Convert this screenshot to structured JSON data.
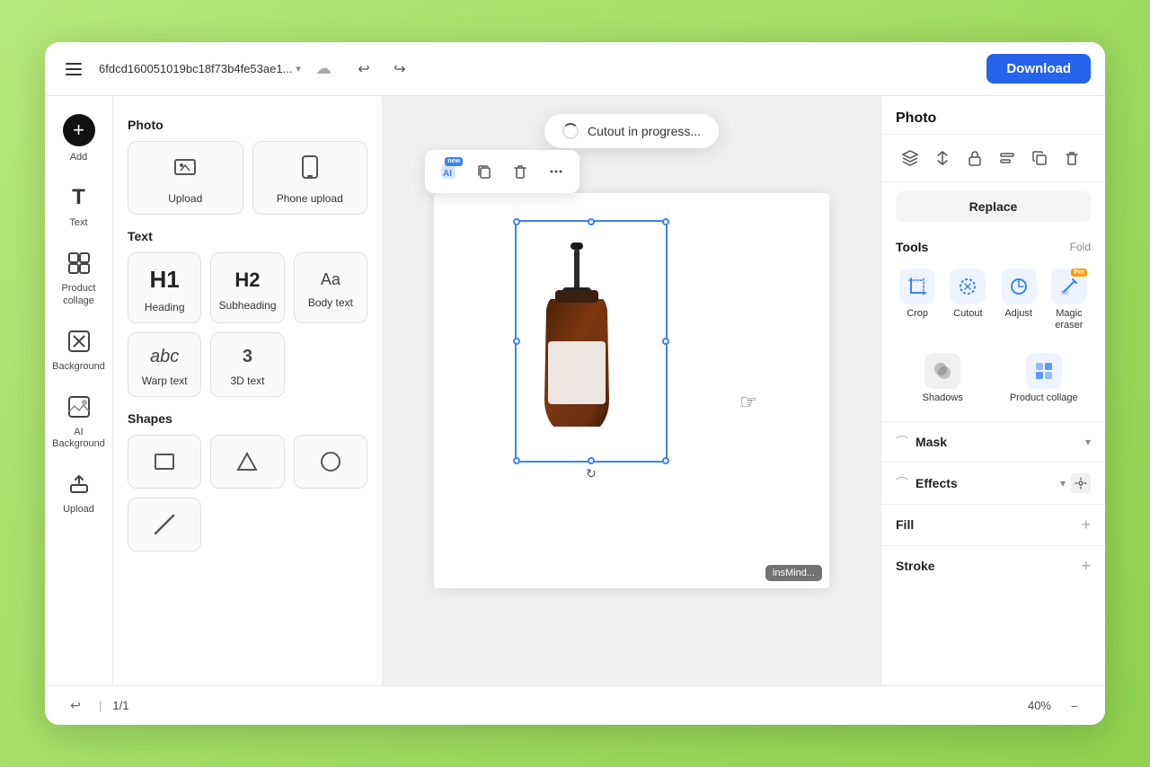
{
  "header": {
    "filename": "6fdcd160051019bc18f73b4fe53ae1...",
    "download_label": "Download",
    "undo_title": "Undo",
    "redo_title": "Redo"
  },
  "left_panel": {
    "photo_section": "Photo",
    "upload_label": "Upload",
    "phone_upload_label": "Phone upload",
    "text_section": "Text",
    "heading_label": "Heading",
    "subheading_label": "Subheading",
    "body_text_label": "Body text",
    "warp_text_label": "Warp text",
    "three_d_text_label": "3D text",
    "shapes_section": "Shapes"
  },
  "icon_sidebar": {
    "add_label": "Add",
    "text_label": "Text",
    "product_collage_label": "Product collage",
    "background_label": "Background",
    "ai_background_label": "AI Background",
    "upload_label": "Upload"
  },
  "canvas": {
    "cutout_toast": "Cutout in progress...",
    "watermark": "insMind..."
  },
  "right_panel": {
    "title": "Photo",
    "replace_label": "Replace",
    "tools_title": "Tools",
    "fold_label": "Fold",
    "crop_label": "Crop",
    "cutout_label": "Cutout",
    "adjust_label": "Adjust",
    "magic_eraser_label": "Magic eraser",
    "shadows_label": "Shadows",
    "product_collage_label": "Product collage",
    "mask_title": "Mask",
    "effects_title": "Effects",
    "fill_title": "Fill",
    "stroke_title": "Stroke"
  },
  "bottom_bar": {
    "page_indicator": "1/1",
    "zoom_label": "40%"
  }
}
